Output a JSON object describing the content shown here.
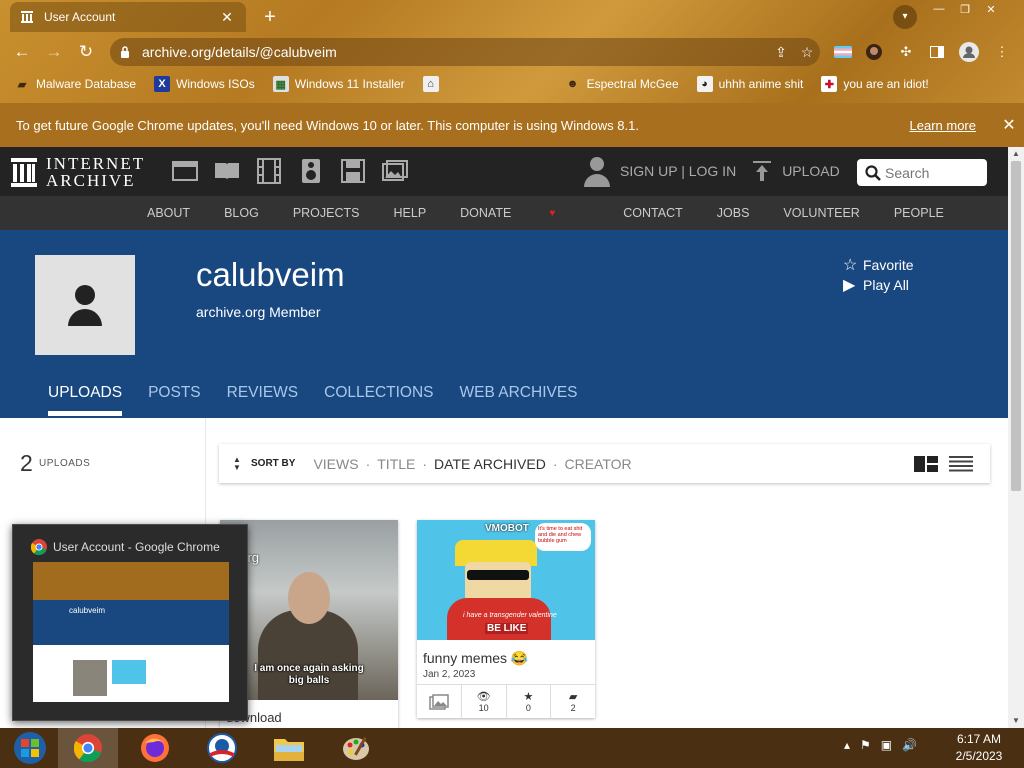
{
  "browser": {
    "tab_title": "User Account",
    "url": "archive.org/details/@calubveim",
    "bookmarks": [
      {
        "label": "Malware Database",
        "icon": "folder-icon"
      },
      {
        "label": "Windows ISOs",
        "icon": "x-icon"
      },
      {
        "label": "Windows 11 Installer",
        "icon": "image-icon"
      },
      {
        "label": "",
        "icon": "film-icon"
      },
      {
        "label": "Espectral McGee",
        "icon": "face-icon"
      },
      {
        "label": "uhhh anime shit",
        "icon": "anime-icon"
      },
      {
        "label": "you are an idiot!",
        "icon": "flag-icon"
      }
    ],
    "infobar_message": "To get future Google Chrome updates, you'll need Windows 10 or later. This computer is using Windows 8.1.",
    "infobar_link": "Learn more"
  },
  "ia": {
    "logo_line1": "INTERNET",
    "logo_line2": "ARCHIVE",
    "signup": "SIGN UP | LOG IN",
    "upload": "UPLOAD",
    "search_placeholder": "Search",
    "nav": [
      "ABOUT",
      "BLOG",
      "PROJECTS",
      "HELP",
      "DONATE",
      "CONTACT",
      "JOBS",
      "VOLUNTEER",
      "PEOPLE"
    ]
  },
  "profile": {
    "username": "calubveim",
    "member_label": "archive.org Member",
    "favorite": "Favorite",
    "play_all": "Play All",
    "tabs": [
      "UPLOADS",
      "POSTS",
      "REVIEWS",
      "COLLECTIONS",
      "WEB ARCHIVES"
    ],
    "active_tab": "UPLOADS"
  },
  "uploads": {
    "count": "2",
    "count_label": "UPLOADS",
    "sort_by_label": "SORT BY",
    "sort_options": [
      "VIEWS",
      "TITLE",
      "DATE ARCHIVED",
      "CREATOR"
    ],
    "active_sort": "DATE ARCHIVED",
    "items": [
      {
        "thumb_watermark": "ive.org",
        "thumb_caption_1": "I am once again asking",
        "thumb_caption_2": "big balls",
        "title": "download"
      },
      {
        "thumb_title": "VMOBOT",
        "thumb_bubble": "It's time to eat shit and die and chew bubble gum",
        "thumb_text": "i have a transgender valentine",
        "thumb_belike": "BE LIKE",
        "title": "funny memes 😂",
        "date": "Jan 2, 2023",
        "views": "10",
        "favorites": "0",
        "reviews": "2"
      }
    ]
  },
  "preview": {
    "title": "User Account - Google Chrome",
    "mini_name": "calubveim"
  },
  "taskbar": {
    "time": "6:17 AM",
    "date": "2/5/2023"
  }
}
